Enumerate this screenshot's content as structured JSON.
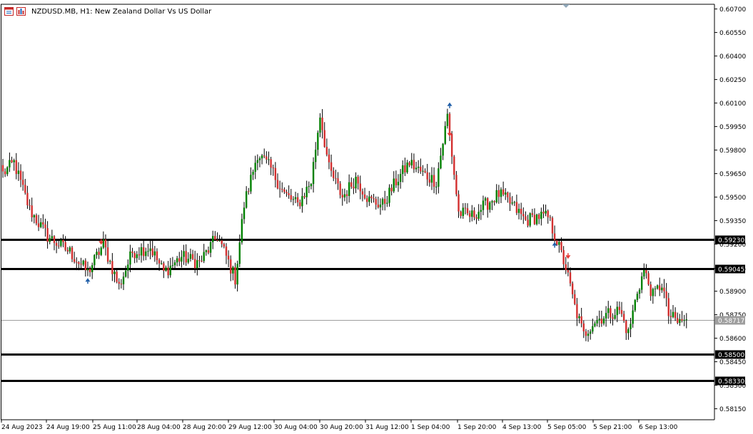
{
  "window": {
    "title": "NZDUSD.MB, H1:  New Zealand Dollar Vs US Dollar",
    "icons": [
      "chart-window-icon",
      "indicator-list-icon"
    ]
  },
  "colors": {
    "bull": "#008000",
    "bear": "#d32f2f",
    "background": "#ffffff",
    "grid_axis": "#000000",
    "current_price_line": "#9e9e9e",
    "current_price_label_bg": "#9e9e9e",
    "level_label_bg": "#000000",
    "arrow_up": "#1f5ea8",
    "arrow_down": "#e53935"
  },
  "chart_data": {
    "type": "candlestick",
    "symbol": "NZDUSD.MB",
    "timeframe": "H1",
    "title": "New Zealand Dollar Vs US Dollar",
    "ylim": [
      0.5808,
      0.6073
    ],
    "y_ticks": [
      "0.60700",
      "0.60550",
      "0.60400",
      "0.60250",
      "0.60100",
      "0.59950",
      "0.59800",
      "0.59650",
      "0.59500",
      "0.59350",
      "0.59200",
      "0.59045",
      "0.58900",
      "0.58750",
      "0.58600",
      "0.58450",
      "0.58300",
      "0.58150"
    ],
    "x_ticks": [
      "24 Aug 2023",
      "24 Aug 19:00",
      "25 Aug 11:00",
      "28 Aug 04:00",
      "28 Aug 20:00",
      "29 Aug 12:00",
      "30 Aug 04:00",
      "30 Aug 20:00",
      "31 Aug 12:00",
      "1 Sep 04:00",
      "1 Sep 20:00",
      "4 Sep 13:00",
      "5 Sep 05:00",
      "5 Sep 21:00",
      "6 Sep 13:00"
    ],
    "horizontal_levels": [
      {
        "price": 0.5923,
        "label": "0.59230"
      },
      {
        "price": 0.59045,
        "label": "0.59045"
      },
      {
        "price": 0.585,
        "label": "0.58500"
      },
      {
        "price": 0.5833,
        "label": "0.58330"
      }
    ],
    "current_price": {
      "price": 0.58717,
      "label": "0.58717"
    },
    "anchors": [
      {
        "i": 0,
        "c": 0.5965
      },
      {
        "i": 5,
        "c": 0.5972
      },
      {
        "i": 12,
        "c": 0.5942
      },
      {
        "i": 20,
        "c": 0.5925
      },
      {
        "i": 30,
        "c": 0.5915
      },
      {
        "i": 38,
        "c": 0.5902
      },
      {
        "i": 45,
        "c": 0.592
      },
      {
        "i": 52,
        "c": 0.5893
      },
      {
        "i": 58,
        "c": 0.5915
      },
      {
        "i": 66,
        "c": 0.5918
      },
      {
        "i": 72,
        "c": 0.5902
      },
      {
        "i": 80,
        "c": 0.5912
      },
      {
        "i": 88,
        "c": 0.5908
      },
      {
        "i": 96,
        "c": 0.5925
      },
      {
        "i": 100,
        "c": 0.5912
      },
      {
        "i": 104,
        "c": 0.5898
      },
      {
        "i": 108,
        "c": 0.5945
      },
      {
        "i": 114,
        "c": 0.5978
      },
      {
        "i": 120,
        "c": 0.5968
      },
      {
        "i": 126,
        "c": 0.5952
      },
      {
        "i": 132,
        "c": 0.5945
      },
      {
        "i": 138,
        "c": 0.596
      },
      {
        "i": 142,
        "c": 0.6003
      },
      {
        "i": 146,
        "c": 0.5968
      },
      {
        "i": 152,
        "c": 0.595
      },
      {
        "i": 158,
        "c": 0.5962
      },
      {
        "i": 164,
        "c": 0.5948
      },
      {
        "i": 170,
        "c": 0.5945
      },
      {
        "i": 176,
        "c": 0.596
      },
      {
        "i": 182,
        "c": 0.5972
      },
      {
        "i": 188,
        "c": 0.5965
      },
      {
        "i": 194,
        "c": 0.596
      },
      {
        "i": 199,
        "c": 0.6002
      },
      {
        "i": 204,
        "c": 0.594
      },
      {
        "i": 210,
        "c": 0.5938
      },
      {
        "i": 216,
        "c": 0.5945
      },
      {
        "i": 222,
        "c": 0.5952
      },
      {
        "i": 228,
        "c": 0.5945
      },
      {
        "i": 234,
        "c": 0.5935
      },
      {
        "i": 240,
        "c": 0.5938
      },
      {
        "i": 244,
        "c": 0.5937
      },
      {
        "i": 248,
        "c": 0.5922
      },
      {
        "i": 252,
        "c": 0.5905
      },
      {
        "i": 256,
        "c": 0.588
      },
      {
        "i": 260,
        "c": 0.5862
      },
      {
        "i": 264,
        "c": 0.587
      },
      {
        "i": 270,
        "c": 0.5875
      },
      {
        "i": 276,
        "c": 0.5878
      },
      {
        "i": 280,
        "c": 0.5863
      },
      {
        "i": 284,
        "c": 0.589
      },
      {
        "i": 287,
        "c": 0.5903
      },
      {
        "i": 291,
        "c": 0.5887
      },
      {
        "i": 295,
        "c": 0.5895
      },
      {
        "i": 298,
        "c": 0.5875
      },
      {
        "i": 302,
        "c": 0.587
      },
      {
        "i": 306,
        "c": 0.5872
      }
    ],
    "markers": [
      {
        "i": 38,
        "price": 0.5897,
        "dir": "up"
      },
      {
        "i": 44,
        "price": 0.5921,
        "dir": "down"
      },
      {
        "i": 200,
        "price": 0.6009,
        "dir": "up"
      },
      {
        "i": 200,
        "price": 0.599,
        "dir": "down"
      },
      {
        "i": 247,
        "price": 0.592,
        "dir": "up"
      },
      {
        "i": 253,
        "price": 0.5912,
        "dir": "down"
      }
    ]
  }
}
